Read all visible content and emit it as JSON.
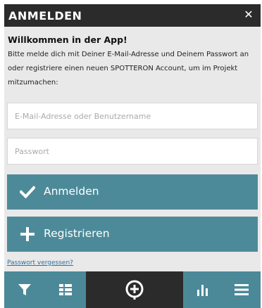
{
  "dialog": {
    "title": "ANMELDEN",
    "close_icon": "close-icon"
  },
  "welcome": {
    "heading": "Willkommen in der App!",
    "line1": "Bitte melde dich mit Deiner E-Mail-Adresse und Deinem Passwort an",
    "line2": "oder registriere einen neuen SPOTTERON Account, um im Projekt",
    "line3": "mitzumachen:"
  },
  "form": {
    "username_placeholder": "E-Mail-Adresse oder Benutzername",
    "password_placeholder": "Passwort",
    "login_label": "Anmelden",
    "login_icon": "checkmark-icon",
    "register_label": "Registrieren",
    "register_icon": "plus-icon",
    "forgot_label": "Passwort vergessen?"
  },
  "bottom_nav": {
    "items": [
      "filter-icon",
      "list-icon",
      "add-spot-icon",
      "stats-icon",
      "menu-icon"
    ]
  },
  "colors": {
    "title_bar": "#2b2b2b",
    "accent": "#4d8a99",
    "background": "#e9e9e9",
    "link": "#2f6f9e"
  }
}
